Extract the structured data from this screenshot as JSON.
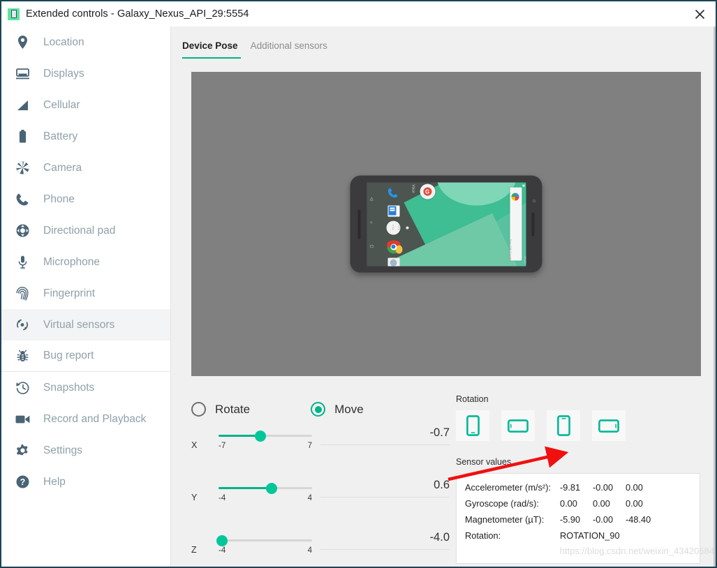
{
  "window": {
    "title": "Extended controls - Galaxy_Nexus_API_29:5554",
    "app_icon": "android-emulator-icon",
    "close_label": "✕"
  },
  "sidebar": {
    "items": [
      {
        "label": "Location",
        "icon": "location-pin-icon"
      },
      {
        "label": "Displays",
        "icon": "display-monitor-icon"
      },
      {
        "label": "Cellular",
        "icon": "signal-bars-icon"
      },
      {
        "label": "Battery",
        "icon": "battery-icon"
      },
      {
        "label": "Camera",
        "icon": "camera-aperture-icon"
      },
      {
        "label": "Phone",
        "icon": "phone-handset-icon"
      },
      {
        "label": "Directional pad",
        "icon": "dpad-icon"
      },
      {
        "label": "Microphone",
        "icon": "microphone-icon"
      },
      {
        "label": "Fingerprint",
        "icon": "fingerprint-icon"
      },
      {
        "label": "Virtual sensors",
        "icon": "virtual-sensors-icon"
      },
      {
        "label": "Bug report",
        "icon": "bug-icon"
      },
      {
        "label": "Snapshots",
        "icon": "history-clock-icon"
      },
      {
        "label": "Record and Playback",
        "icon": "video-camera-icon"
      },
      {
        "label": "Settings",
        "icon": "gear-icon"
      },
      {
        "label": "Help",
        "icon": "question-mark-icon"
      }
    ],
    "selected_index": 9
  },
  "main": {
    "tabs": [
      {
        "label": "Device Pose",
        "active": true
      },
      {
        "label": "Additional sensors",
        "active": false
      }
    ],
    "preview": {
      "device": "Galaxy Nexus phone preview, rotated to landscape"
    },
    "mode": {
      "options": [
        {
          "label": "Rotate",
          "selected": false
        },
        {
          "label": "Move",
          "selected": true
        }
      ]
    },
    "sliders": [
      {
        "axis": "X",
        "min": "-7",
        "max": "7",
        "value": "-0.7",
        "fill_pct": 45
      },
      {
        "axis": "Y",
        "min": "-4",
        "max": "4",
        "value": "0.6",
        "fill_pct": 57
      },
      {
        "axis": "Z",
        "min": "-4",
        "max": "4",
        "value": "-4.0",
        "fill_pct": 4
      }
    ],
    "rotation": {
      "title": "Rotation",
      "buttons": [
        {
          "name": "portrait",
          "icon": "phone-portrait-icon"
        },
        {
          "name": "landscape",
          "icon": "phone-landscape-icon"
        },
        {
          "name": "reverse-portrait",
          "icon": "phone-reverse-portrait-icon"
        },
        {
          "name": "reverse-landscape",
          "icon": "phone-reverse-landscape-icon"
        }
      ]
    },
    "sensors": {
      "title": "Sensor values",
      "rows": [
        {
          "label": "Accelerometer (m/s²):",
          "v1": "-9.81",
          "v2": "-0.00",
          "v3": "0.00"
        },
        {
          "label": "Gyroscope (rad/s):",
          "v1": "0.00",
          "v2": "0.00",
          "v3": "0.00"
        },
        {
          "label": "Magnetometer (µT):",
          "v1": "-5.90",
          "v2": "-0.00",
          "v3": "-48.40"
        }
      ],
      "rotation_label": "Rotation:",
      "rotation_value": "ROTATION_90"
    }
  },
  "annotation": {
    "arrow_color": "#f01010",
    "shape": "red-arrow-pointing-to-accelerometer"
  },
  "watermark": {
    "text": "https://blog.csdn.net/weixin_43420684"
  },
  "colors": {
    "accent": "#00b388",
    "thumb": "#00c79a",
    "sidebar_text": "#90a0ab",
    "icon": "#4a6475",
    "panel_bg": "#f0f0f0",
    "preview_bg": "#808080",
    "window_border": "#1d4456"
  }
}
